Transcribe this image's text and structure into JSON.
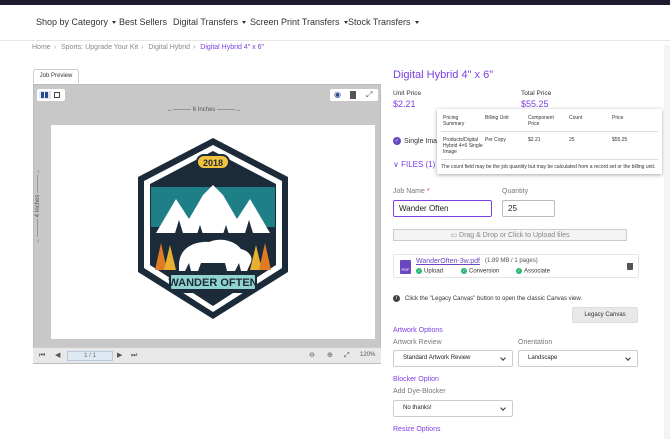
{
  "nav": {
    "items": [
      {
        "label": "Shop by Category",
        "dropdown": true
      },
      {
        "label": "Best Sellers",
        "dropdown": false
      },
      {
        "label": "Digital Transfers",
        "dropdown": true
      },
      {
        "label": "Screen Print Transfers",
        "dropdown": true
      },
      {
        "label": "Stock Transfers",
        "dropdown": true
      }
    ]
  },
  "breadcrumb": {
    "items": [
      "Home",
      "Sports: Upgrade Your Kit",
      "Digital Hybrid"
    ],
    "current": "Digital Hybrid 4\" x 6\""
  },
  "preview": {
    "tab_label": "Job Preview",
    "width_label": "6 Inches",
    "height_label": "4 Inches",
    "page_indicator": "1 / 1",
    "zoom_level": "120%",
    "badge_year": "2018",
    "badge_text": "WANDER OFTEN"
  },
  "product": {
    "title": "Digital Hybrid 4\" x 6\"",
    "unit_price_label": "Unit Price",
    "unit_price": "$2.21",
    "total_price_label": "Total Price",
    "total_price": "$55.25"
  },
  "pricing_tooltip": {
    "headers": [
      "Pricing Summary",
      "Billing Unit",
      "Component Price",
      "Count",
      "Price"
    ],
    "row": {
      "summary": "Products/Digital Hybrid 4×6 Single Image",
      "billing_unit": "Per Copy",
      "component_price": "$2.21",
      "count": "25",
      "price": "$55.25"
    },
    "note": "The count field may be the job quantity but may be calculated from a record set or the billing unit."
  },
  "options": {
    "single_image": "Single Imag",
    "files_label": "FILES (1)"
  },
  "job": {
    "name_label": "Job Name",
    "required_mark": "*",
    "name_value": "Wander Often",
    "quantity_label": "Quantity",
    "quantity_value": "25"
  },
  "upload": {
    "drop_label": "Drag & Drop or Click to Upload files",
    "file_name": "WanderOften-3w.pdf",
    "file_meta": "(1.89 MB / 1 pages)",
    "steps": [
      "Upload",
      "Conversion",
      "Associate"
    ],
    "pdf_badge": "PDF"
  },
  "legacy": {
    "info_text": "Click the \"Legacy Canvas\" button to open the classic Canvas view.",
    "button_label": "Legacy Canvas"
  },
  "artwork": {
    "section_title": "Artwork Options",
    "review_label": "Artwork Review",
    "review_value": "Standard Artwork Review",
    "orientation_label": "Orientation",
    "orientation_value": "Landscape"
  },
  "blocker": {
    "section_title": "Blocker Option",
    "label": "Add Dye-Blocker",
    "value": "No thanks!"
  },
  "resize": {
    "section_title": "Resize Options"
  },
  "colors": {
    "accent": "#7b3fe4",
    "badge_teal": "#1e7f86",
    "badge_dark": "#1c2b39",
    "badge_yellow": "#f2c43d",
    "success": "#2bb673"
  }
}
